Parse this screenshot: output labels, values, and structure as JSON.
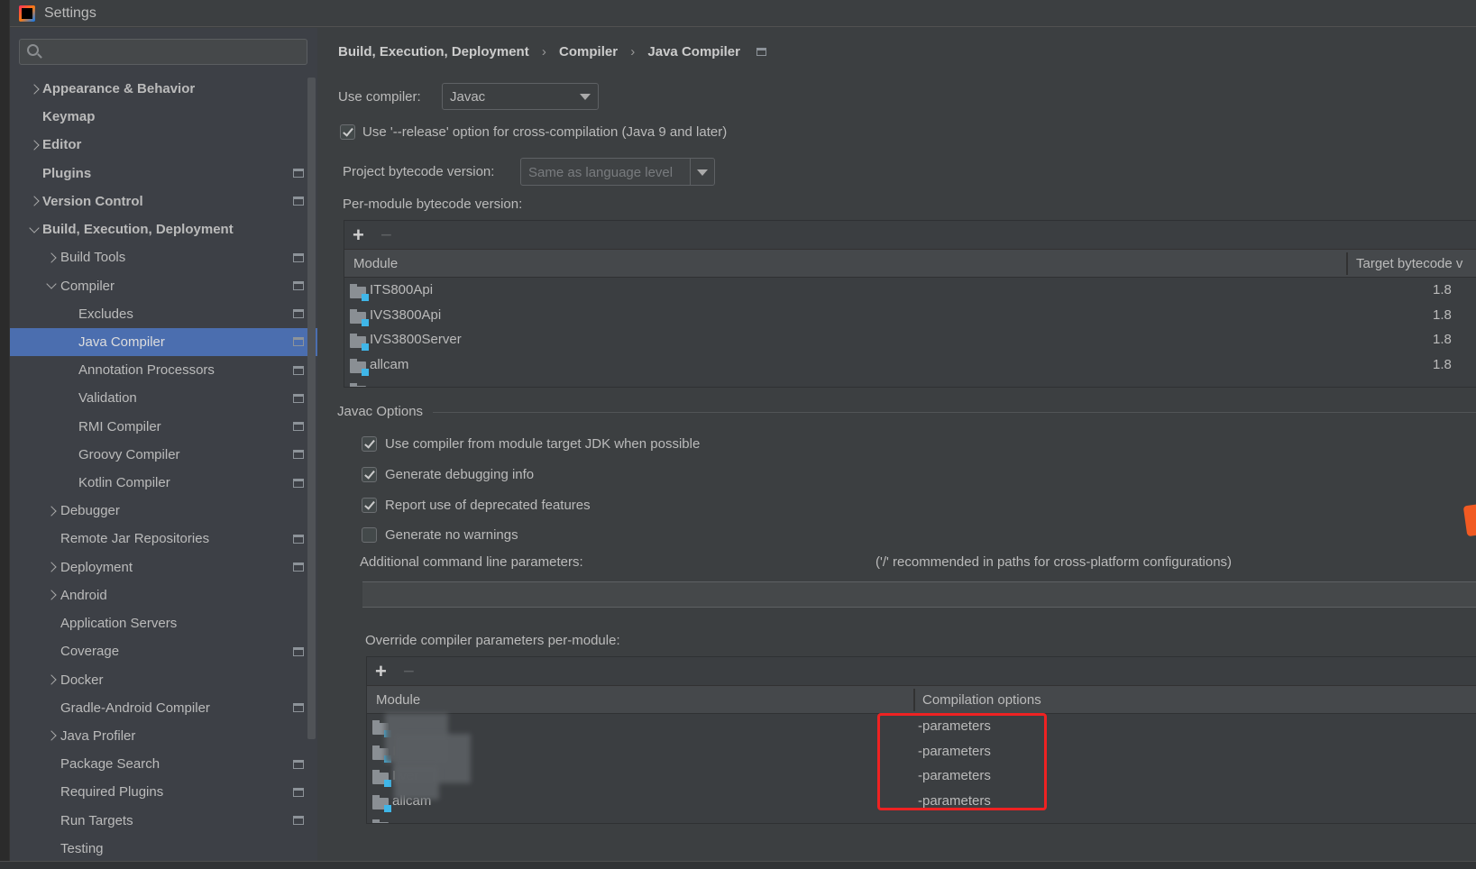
{
  "window": {
    "title": "Settings",
    "logo": "intellij-idea-logo"
  },
  "search": {
    "placeholder": "",
    "value": ""
  },
  "sidebar": {
    "items": [
      {
        "label": "Appearance & Behavior",
        "level": 0,
        "chevron": "right",
        "bold": true,
        "project_icon": false
      },
      {
        "label": "Keymap",
        "level": 0,
        "chevron": "none",
        "bold": true,
        "project_icon": false
      },
      {
        "label": "Editor",
        "level": 0,
        "chevron": "right",
        "bold": true,
        "project_icon": false
      },
      {
        "label": "Plugins",
        "level": 0,
        "chevron": "none",
        "bold": true,
        "project_icon": true
      },
      {
        "label": "Version Control",
        "level": 0,
        "chevron": "right",
        "bold": true,
        "project_icon": true
      },
      {
        "label": "Build, Execution, Deployment",
        "level": 0,
        "chevron": "down",
        "bold": true,
        "project_icon": false
      },
      {
        "label": "Build Tools",
        "level": 1,
        "chevron": "right",
        "bold": false,
        "project_icon": true
      },
      {
        "label": "Compiler",
        "level": 1,
        "chevron": "down",
        "bold": false,
        "project_icon": true
      },
      {
        "label": "Excludes",
        "level": 2,
        "chevron": "none",
        "bold": false,
        "project_icon": true
      },
      {
        "label": "Java Compiler",
        "level": 2,
        "chevron": "none",
        "bold": false,
        "project_icon": true,
        "selected": true
      },
      {
        "label": "Annotation Processors",
        "level": 2,
        "chevron": "none",
        "bold": false,
        "project_icon": true
      },
      {
        "label": "Validation",
        "level": 2,
        "chevron": "none",
        "bold": false,
        "project_icon": true
      },
      {
        "label": "RMI Compiler",
        "level": 2,
        "chevron": "none",
        "bold": false,
        "project_icon": true
      },
      {
        "label": "Groovy Compiler",
        "level": 2,
        "chevron": "none",
        "bold": false,
        "project_icon": true
      },
      {
        "label": "Kotlin Compiler",
        "level": 2,
        "chevron": "none",
        "bold": false,
        "project_icon": true
      },
      {
        "label": "Debugger",
        "level": 1,
        "chevron": "right",
        "bold": false,
        "project_icon": false
      },
      {
        "label": "Remote Jar Repositories",
        "level": 1,
        "chevron": "none",
        "bold": false,
        "project_icon": true
      },
      {
        "label": "Deployment",
        "level": 1,
        "chevron": "right",
        "bold": false,
        "project_icon": true
      },
      {
        "label": "Android",
        "level": 1,
        "chevron": "right",
        "bold": false,
        "project_icon": false
      },
      {
        "label": "Application Servers",
        "level": 1,
        "chevron": "none",
        "bold": false,
        "project_icon": false
      },
      {
        "label": "Coverage",
        "level": 1,
        "chevron": "none",
        "bold": false,
        "project_icon": true
      },
      {
        "label": "Docker",
        "level": 1,
        "chevron": "right",
        "bold": false,
        "project_icon": false
      },
      {
        "label": "Gradle-Android Compiler",
        "level": 1,
        "chevron": "none",
        "bold": false,
        "project_icon": true
      },
      {
        "label": "Java Profiler",
        "level": 1,
        "chevron": "right",
        "bold": false,
        "project_icon": false
      },
      {
        "label": "Package Search",
        "level": 1,
        "chevron": "none",
        "bold": false,
        "project_icon": true
      },
      {
        "label": "Required Plugins",
        "level": 1,
        "chevron": "none",
        "bold": false,
        "project_icon": true
      },
      {
        "label": "Run Targets",
        "level": 1,
        "chevron": "none",
        "bold": false,
        "project_icon": true
      },
      {
        "label": "Testing",
        "level": 1,
        "chevron": "none",
        "bold": false,
        "project_icon": false
      }
    ]
  },
  "breadcrumb": [
    "Build, Execution, Deployment",
    "Compiler",
    "Java Compiler"
  ],
  "main": {
    "use_compiler_label": "Use compiler:",
    "use_compiler_value": "Javac",
    "release_option": {
      "label": "Use '--release' option for cross-compilation (Java 9 and later)",
      "checked": true
    },
    "project_bytecode_label": "Project bytecode version:",
    "project_bytecode_value": "Same as language level",
    "per_module_label": "Per-module bytecode version:",
    "bytecode_table": {
      "columns": [
        "Module",
        "Target bytecode v"
      ],
      "rows": [
        {
          "module": "ITS800Api",
          "target": "1.8"
        },
        {
          "module": "IVS3800Api",
          "target": "1.8"
        },
        {
          "module": "IVS3800Server",
          "target": "1.8"
        },
        {
          "module": "allcam",
          "target": "1.8"
        }
      ]
    },
    "javac_options_title": "Javac Options",
    "javac_options": [
      {
        "label": "Use compiler from module target JDK when possible",
        "checked": true
      },
      {
        "label": "Generate debugging info",
        "checked": true
      },
      {
        "label": "Report use of deprecated features",
        "checked": true
      },
      {
        "label": "Generate no warnings",
        "checked": false
      }
    ],
    "additional_params_label": "Additional command line parameters:",
    "additional_params_hint": "('/' recommended in paths for cross-platform configurations)",
    "additional_params_value": "",
    "override_label": "Override compiler parameters per-module:",
    "override_table": {
      "columns": [
        "Module",
        "Compilation options"
      ],
      "rows": [
        {
          "module": "",
          "options": "-parameters"
        },
        {
          "module": "I",
          "options": "-parameters"
        },
        {
          "module": "I                ver",
          "options": "-parameters"
        },
        {
          "module": "allcam",
          "options": "-parameters"
        }
      ]
    },
    "highlight_color": "#ee2222"
  },
  "colors": {
    "selection": "#4b6eaf",
    "background": "#3c3f41",
    "module_badge": "#3fb6e8"
  }
}
